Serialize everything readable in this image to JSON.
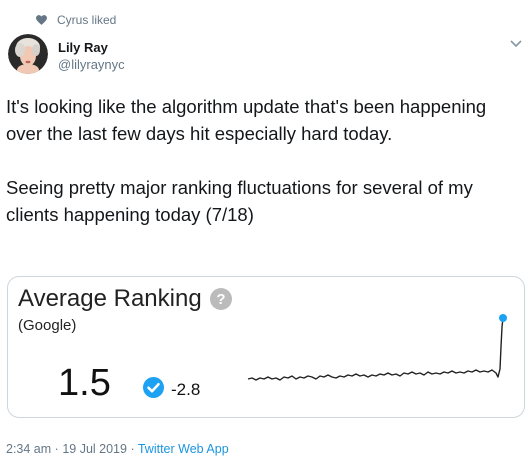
{
  "social_context": {
    "text": "Cyrus liked",
    "icon": "heart-icon"
  },
  "author": {
    "name": "Lily Ray",
    "handle": "@lilyraynyc"
  },
  "tweet": {
    "text": "It's looking like the algorithm update that's been happening over the last few days hit especially hard today.\n\nSeeing pretty major ranking fluctuations for several of my clients happening today (7/18)"
  },
  "card": {
    "title": "Average Ranking",
    "subtitle": "(Google)",
    "value": "1.5",
    "delta": "-2.8",
    "icons": {
      "help": "help-icon",
      "status": "check-circle-icon"
    },
    "colors": {
      "accent": "#1da1f2",
      "line": "#222222",
      "help_icon": "#bbbbbb"
    }
  },
  "footer": {
    "time": "2:34 am",
    "sep1": "·",
    "date": "19 Jul 2019",
    "sep2": "·",
    "app": "Twitter Web App"
  }
}
